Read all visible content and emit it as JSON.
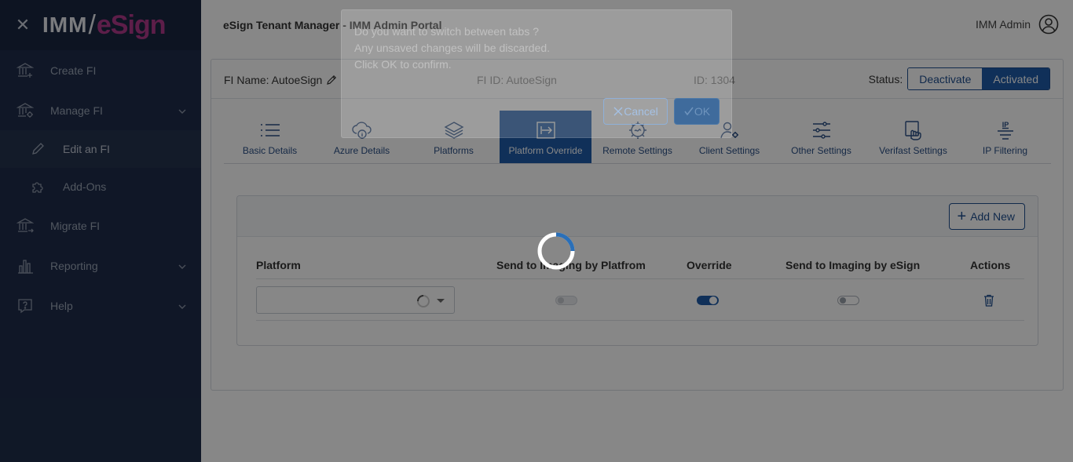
{
  "sidebar": {
    "close_icon": "close-icon",
    "logo_imm": "IMM",
    "logo_esign": "eSign",
    "items": [
      {
        "label": "Create FI",
        "icon": "bank-plus-icon"
      },
      {
        "label": "Manage FI",
        "icon": "bank-gear-icon"
      },
      {
        "label": "Edit an FI",
        "icon": "pencil-icon"
      },
      {
        "label": "Add-Ons",
        "icon": "puzzle-icon"
      },
      {
        "label": "Migrate FI",
        "icon": "bank-arrow-icon"
      },
      {
        "label": "Reporting",
        "icon": "bar-chart-icon"
      },
      {
        "label": "Help",
        "icon": "question-icon"
      }
    ]
  },
  "header": {
    "title": "eSign Tenant Manager - IMM Admin Portal",
    "user": "IMM Admin"
  },
  "fi": {
    "name": "FI Name: AutoeSign",
    "fi_id": "FI ID: AutoeSign",
    "id": "ID: 1304",
    "status_label": "Status:",
    "deactivate": "Deactivate",
    "activated": "Activated"
  },
  "tabs": [
    {
      "label": "Basic Details"
    },
    {
      "label": "Azure Details"
    },
    {
      "label": "Platforms"
    },
    {
      "label": "Platform Override"
    },
    {
      "label": "Remote Settings"
    },
    {
      "label": "Client Settings"
    },
    {
      "label": "Other Settings"
    },
    {
      "label": "Verifast Settings"
    },
    {
      "label": "IP Filtering"
    }
  ],
  "panel": {
    "add_new": "Add New",
    "columns": {
      "platform": "Platform",
      "send_platform": "Send to Imaging by Platfrom",
      "override": "Override",
      "send_esign": "Send to Imaging by eSign",
      "actions": "Actions"
    },
    "row": {
      "send_platform_on": false,
      "override_on": true,
      "send_esign_on": false
    }
  },
  "dialog": {
    "line1": "Do you want to switch between tabs ?",
    "line2": "Any unsaved changes will be discarded.",
    "line3": "Click OK to confirm.",
    "cancel": "Cancel",
    "ok": "OK"
  },
  "colors": {
    "sidebar": "#1f2d4a",
    "accent": "#1f5ca8"
  }
}
